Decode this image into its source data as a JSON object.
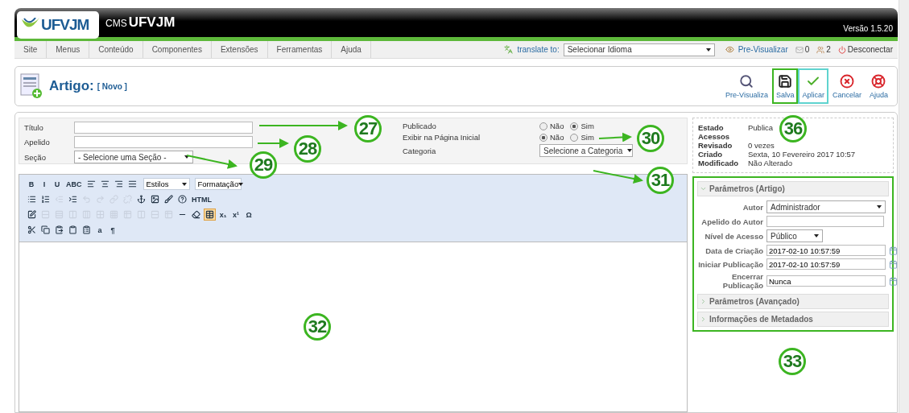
{
  "header": {
    "logo": "UFVJM",
    "cms_prefix": "CMS",
    "cms_name": "UFVJM",
    "version": "Versão 1.5.20"
  },
  "menu": [
    {
      "label": "Site"
    },
    {
      "label": "Menus"
    },
    {
      "label": "Conteúdo"
    },
    {
      "label": "Componentes"
    },
    {
      "label": "Extensões"
    },
    {
      "label": "Ferramentas"
    },
    {
      "label": "Ajuda"
    }
  ],
  "status": {
    "translate_label": "translate to:",
    "language_select": "Selecionar Idioma",
    "preview_link": "Pre-Visualizar",
    "messages_count": "0",
    "users_count": "2",
    "logout": "Desconectar"
  },
  "page_title": {
    "title": "Artigo:",
    "subtitle": "[ Novo ]"
  },
  "toolbar_buttons": [
    {
      "label": "Pre-Visualiza"
    },
    {
      "label": "Salva",
      "color": "#3cb521"
    },
    {
      "label": "Aplicar",
      "color": "#5fd3cf"
    },
    {
      "label": "Cancelar"
    },
    {
      "label": "Ajuda"
    }
  ],
  "form_left": [
    {
      "kind": "input",
      "label": "Título"
    },
    {
      "kind": "input",
      "label": "Apelido"
    },
    {
      "kind": "select",
      "label": "Seção",
      "value": "- Selecione uma Seção -"
    }
  ],
  "form_right": [
    {
      "kind": "radio",
      "label": "Publicado",
      "options": [
        {
          "label": "Não",
          "selected": false
        },
        {
          "label": "Sim",
          "selected": true
        }
      ]
    },
    {
      "kind": "radio",
      "label": "Exibir na Página Inicial",
      "options": [
        {
          "label": "Não",
          "selected": true
        },
        {
          "label": "Sim",
          "selected": false
        }
      ]
    },
    {
      "kind": "select",
      "label": "Categoria",
      "value": "Selecione a Categoria"
    }
  ],
  "editor": {
    "toolbar_rows": [
      [
        {
          "kind": "text",
          "label": "B",
          "disabled": false,
          "active": false
        },
        {
          "kind": "text",
          "label": "I",
          "disabled": false,
          "active": false
        },
        {
          "kind": "text",
          "label": "U",
          "disabled": false,
          "active": false
        },
        {
          "kind": "text",
          "label": "ABC",
          "disabled": false,
          "active": false
        },
        {
          "kind": "icon",
          "disabled": false,
          "active": false
        },
        {
          "kind": "icon",
          "disabled": false,
          "active": false
        },
        {
          "kind": "icon",
          "disabled": false,
          "active": false
        },
        {
          "kind": "icon",
          "disabled": false,
          "active": false
        },
        {
          "kind": "select",
          "label": "Estilos"
        },
        {
          "kind": "select",
          "label": "Formatação"
        }
      ],
      [
        {
          "kind": "icon",
          "disabled": false,
          "active": false
        },
        {
          "kind": "icon",
          "disabled": false,
          "active": false
        },
        {
          "kind": "icon",
          "disabled": true,
          "active": false
        },
        {
          "kind": "icon",
          "disabled": false,
          "active": false
        },
        {
          "kind": "icon",
          "disabled": true,
          "active": false
        },
        {
          "kind": "icon",
          "disabled": true,
          "active": false
        },
        {
          "kind": "icon",
          "disabled": true,
          "active": false
        },
        {
          "kind": "icon",
          "disabled": true,
          "active": false
        },
        {
          "kind": "icon",
          "disabled": false,
          "active": false
        },
        {
          "kind": "icon",
          "disabled": false,
          "active": false
        },
        {
          "kind": "icon",
          "disabled": false,
          "active": false
        },
        {
          "kind": "icon",
          "disabled": false,
          "active": false
        },
        {
          "kind": "text",
          "label": "HTML",
          "disabled": false,
          "active": false
        }
      ],
      [
        {
          "kind": "icon",
          "disabled": false,
          "active": false
        },
        {
          "kind": "icon",
          "disabled": true,
          "active": false
        },
        {
          "kind": "icon",
          "disabled": true,
          "active": false
        },
        {
          "kind": "icon",
          "disabled": true,
          "active": false
        },
        {
          "kind": "icon",
          "disabled": true,
          "active": false
        },
        {
          "kind": "icon",
          "disabled": true,
          "active": false
        },
        {
          "kind": "icon",
          "disabled": true,
          "active": false
        },
        {
          "kind": "icon",
          "disabled": true,
          "active": false
        },
        {
          "kind": "icon",
          "disabled": true,
          "active": false
        },
        {
          "kind": "icon",
          "disabled": true,
          "active": false
        },
        {
          "kind": "icon",
          "disabled": true,
          "active": false
        },
        {
          "kind": "icon",
          "disabled": false,
          "active": false
        },
        {
          "kind": "icon",
          "disabled": false,
          "active": false
        },
        {
          "kind": "icon",
          "disabled": false,
          "active": true
        },
        {
          "kind": "text",
          "label": "x₁",
          "disabled": false,
          "active": false
        },
        {
          "kind": "text",
          "label": "x¹",
          "disabled": false,
          "active": false
        },
        {
          "kind": "text",
          "label": "Ω",
          "disabled": false,
          "active": false
        }
      ],
      [
        {
          "kind": "icon",
          "disabled": false,
          "active": false
        },
        {
          "kind": "icon",
          "disabled": false,
          "active": false
        },
        {
          "kind": "icon",
          "disabled": false,
          "active": false
        },
        {
          "kind": "icon",
          "disabled": false,
          "active": false
        },
        {
          "kind": "icon",
          "disabled": false,
          "active": false
        },
        {
          "kind": "text",
          "label": "a",
          "disabled": false,
          "active": false
        },
        {
          "kind": "text",
          "label": "¶",
          "disabled": false,
          "active": false
        }
      ]
    ]
  },
  "details": [
    {
      "label": "Estado",
      "value": "Publica"
    },
    {
      "label": "Acessos"
    },
    {
      "label": "Revisado",
      "value": "0 vezes"
    },
    {
      "label": "Criado",
      "value": "Sexta, 10 Fevereiro 2017 10:57"
    },
    {
      "label": "Modificado",
      "value": "Não Alterado"
    }
  ],
  "parameters": {
    "color": "#3cb521",
    "sections": [
      {
        "title": "Parâmetros (Artigo)",
        "expanded": true,
        "fields": [
          {
            "kind": "select",
            "label": "Autor",
            "value": "Administrador"
          },
          {
            "kind": "input",
            "label": "Apelido do Autor"
          },
          {
            "kind": "select",
            "label": "Nível de Acesso",
            "value": "Público"
          },
          {
            "kind": "date",
            "label": "Data de Criação",
            "value": "2017-02-10 10:57:59"
          },
          {
            "kind": "date",
            "label": "Iniciar Publicação",
            "value": "2017-02-10 10:57:59"
          },
          {
            "kind": "date",
            "label": "Encerrar Publicação",
            "value": "Nunca"
          }
        ]
      },
      {
        "title": "Parâmetros (Avançado)",
        "expanded": false
      },
      {
        "title": "Informações de Metadados",
        "expanded": false
      }
    ]
  },
  "callouts": [
    {
      "number": "27"
    },
    {
      "number": "28"
    },
    {
      "number": "29"
    },
    {
      "number": "30"
    },
    {
      "number": "31"
    },
    {
      "number": "32"
    },
    {
      "number": "33"
    },
    {
      "number": "36"
    }
  ]
}
